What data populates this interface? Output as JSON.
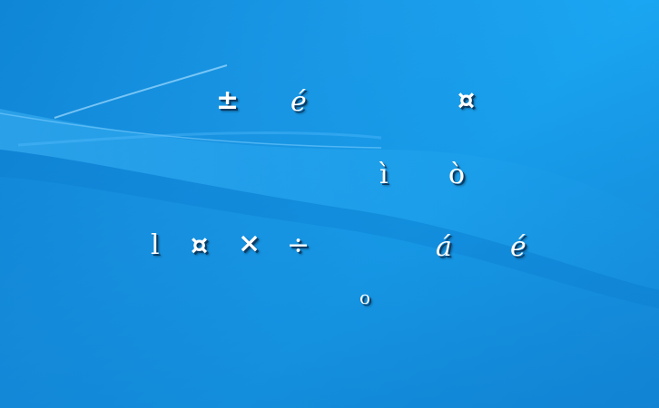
{
  "desktop": {
    "glyphs": {
      "g1": "±",
      "g2": "é",
      "g3": "¤",
      "g4": "ì",
      "g5": "ò",
      "g6": "l",
      "g7": "¤",
      "g8": "×",
      "g9": "÷",
      "g10": "á",
      "g11": "é",
      "g12": "o"
    },
    "colors": {
      "background": "#1a9ae8",
      "glyph": "#ffffff",
      "glyph_shadow": "#0a3c66"
    }
  }
}
